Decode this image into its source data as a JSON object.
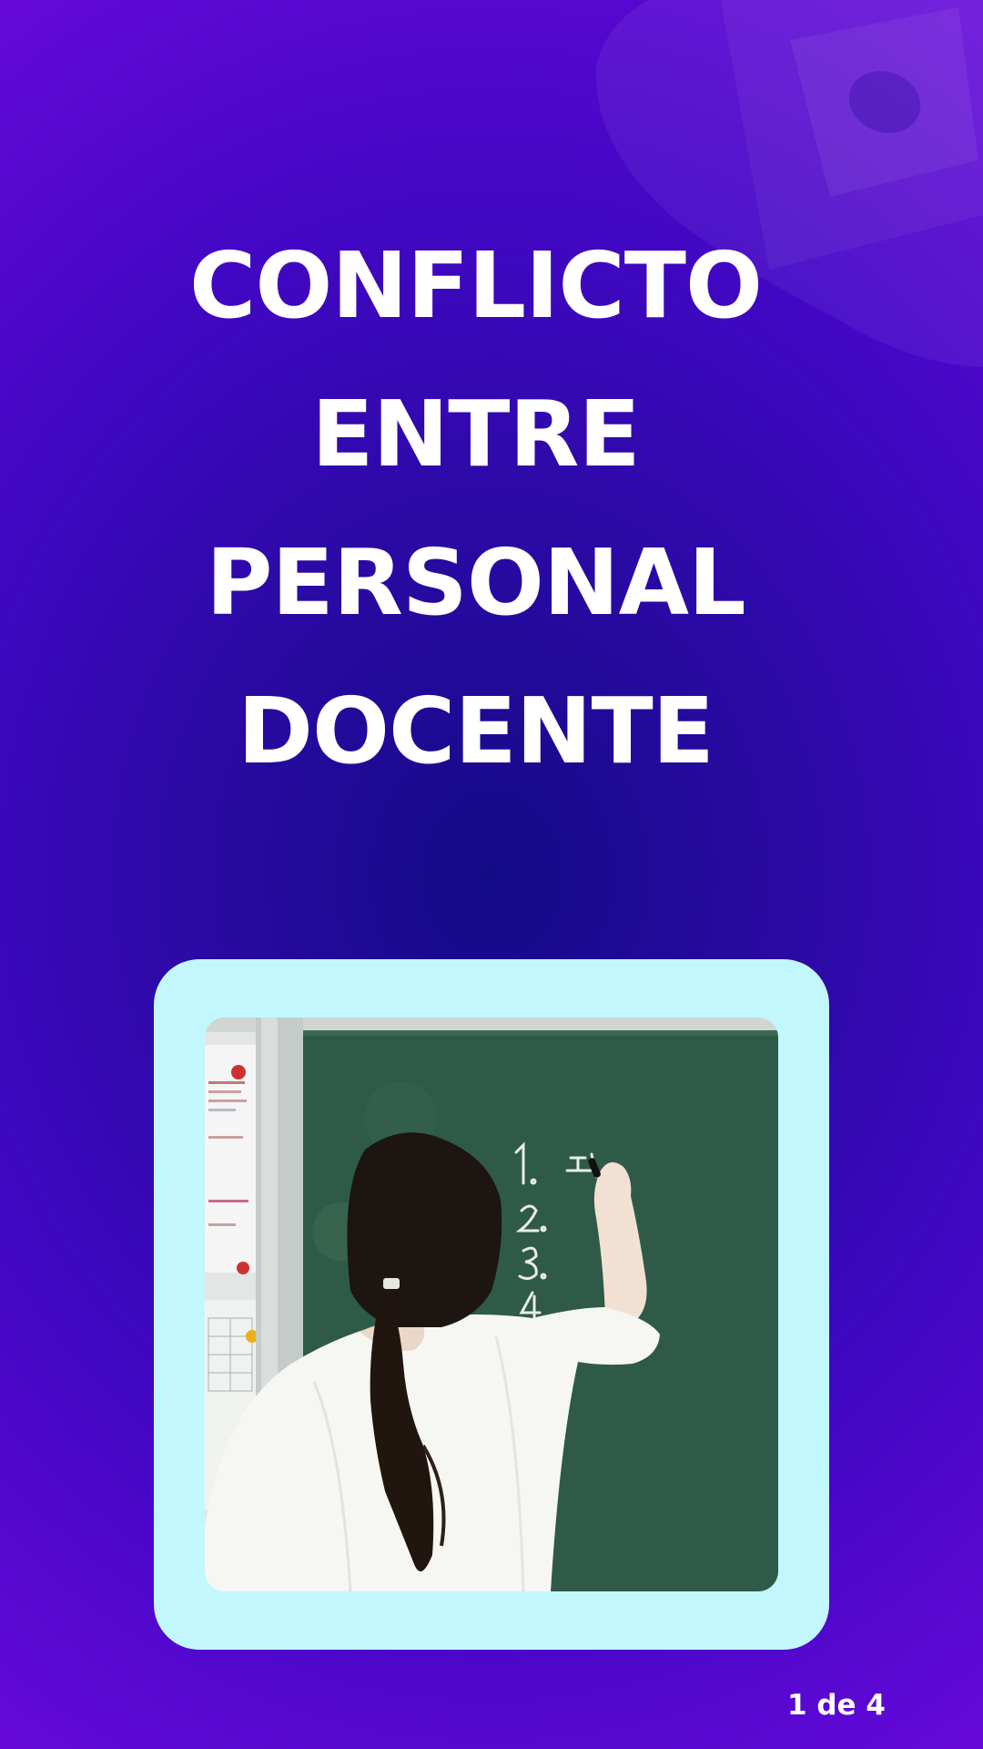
{
  "slide": {
    "title_lines": [
      "CONFLICTO",
      "ENTRE",
      "PERSONAL",
      "DOCENTE"
    ],
    "page_indicator": "1 de 4"
  },
  "photo": {
    "subject": "teacher-writing-on-chalkboard",
    "board_lines": [
      "1. 교실",
      "2.",
      "3.",
      "4."
    ]
  },
  "colors": {
    "background_center": "#140a86",
    "background_edge": "#6a08dc",
    "card_frame": "#c2f8fd",
    "title_text": "#ffffff",
    "chalkboard": "#2f5a48"
  }
}
